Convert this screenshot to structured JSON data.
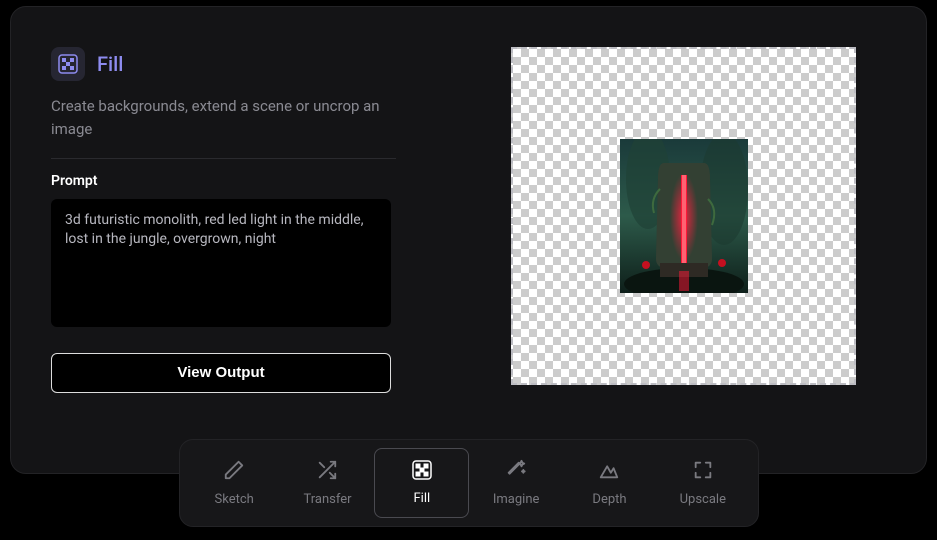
{
  "tool": {
    "title": "Fill",
    "description": "Create backgrounds, extend a scene or uncrop an image",
    "icon": "fill-checker-icon"
  },
  "prompt": {
    "label": "Prompt",
    "value": "3d futuristic monolith, red led light in the middle, lost in the jungle, overgrown, night"
  },
  "actions": {
    "view_output": "View Output"
  },
  "canvas": {
    "image_alt": "monolith-jungle-preview"
  },
  "toolbar": {
    "items": [
      {
        "id": "sketch",
        "label": "Sketch",
        "icon": "pencil-icon",
        "active": false
      },
      {
        "id": "transfer",
        "label": "Transfer",
        "icon": "shuffle-icon",
        "active": false
      },
      {
        "id": "fill",
        "label": "Fill",
        "icon": "fill-checker-icon",
        "active": true
      },
      {
        "id": "imagine",
        "label": "Imagine",
        "icon": "magic-wand-icon",
        "active": false
      },
      {
        "id": "depth",
        "label": "Depth",
        "icon": "mountain-icon",
        "active": false
      },
      {
        "id": "upscale",
        "label": "Upscale",
        "icon": "expand-icon",
        "active": false
      }
    ]
  },
  "colors": {
    "accent": "#8e8cf0"
  }
}
